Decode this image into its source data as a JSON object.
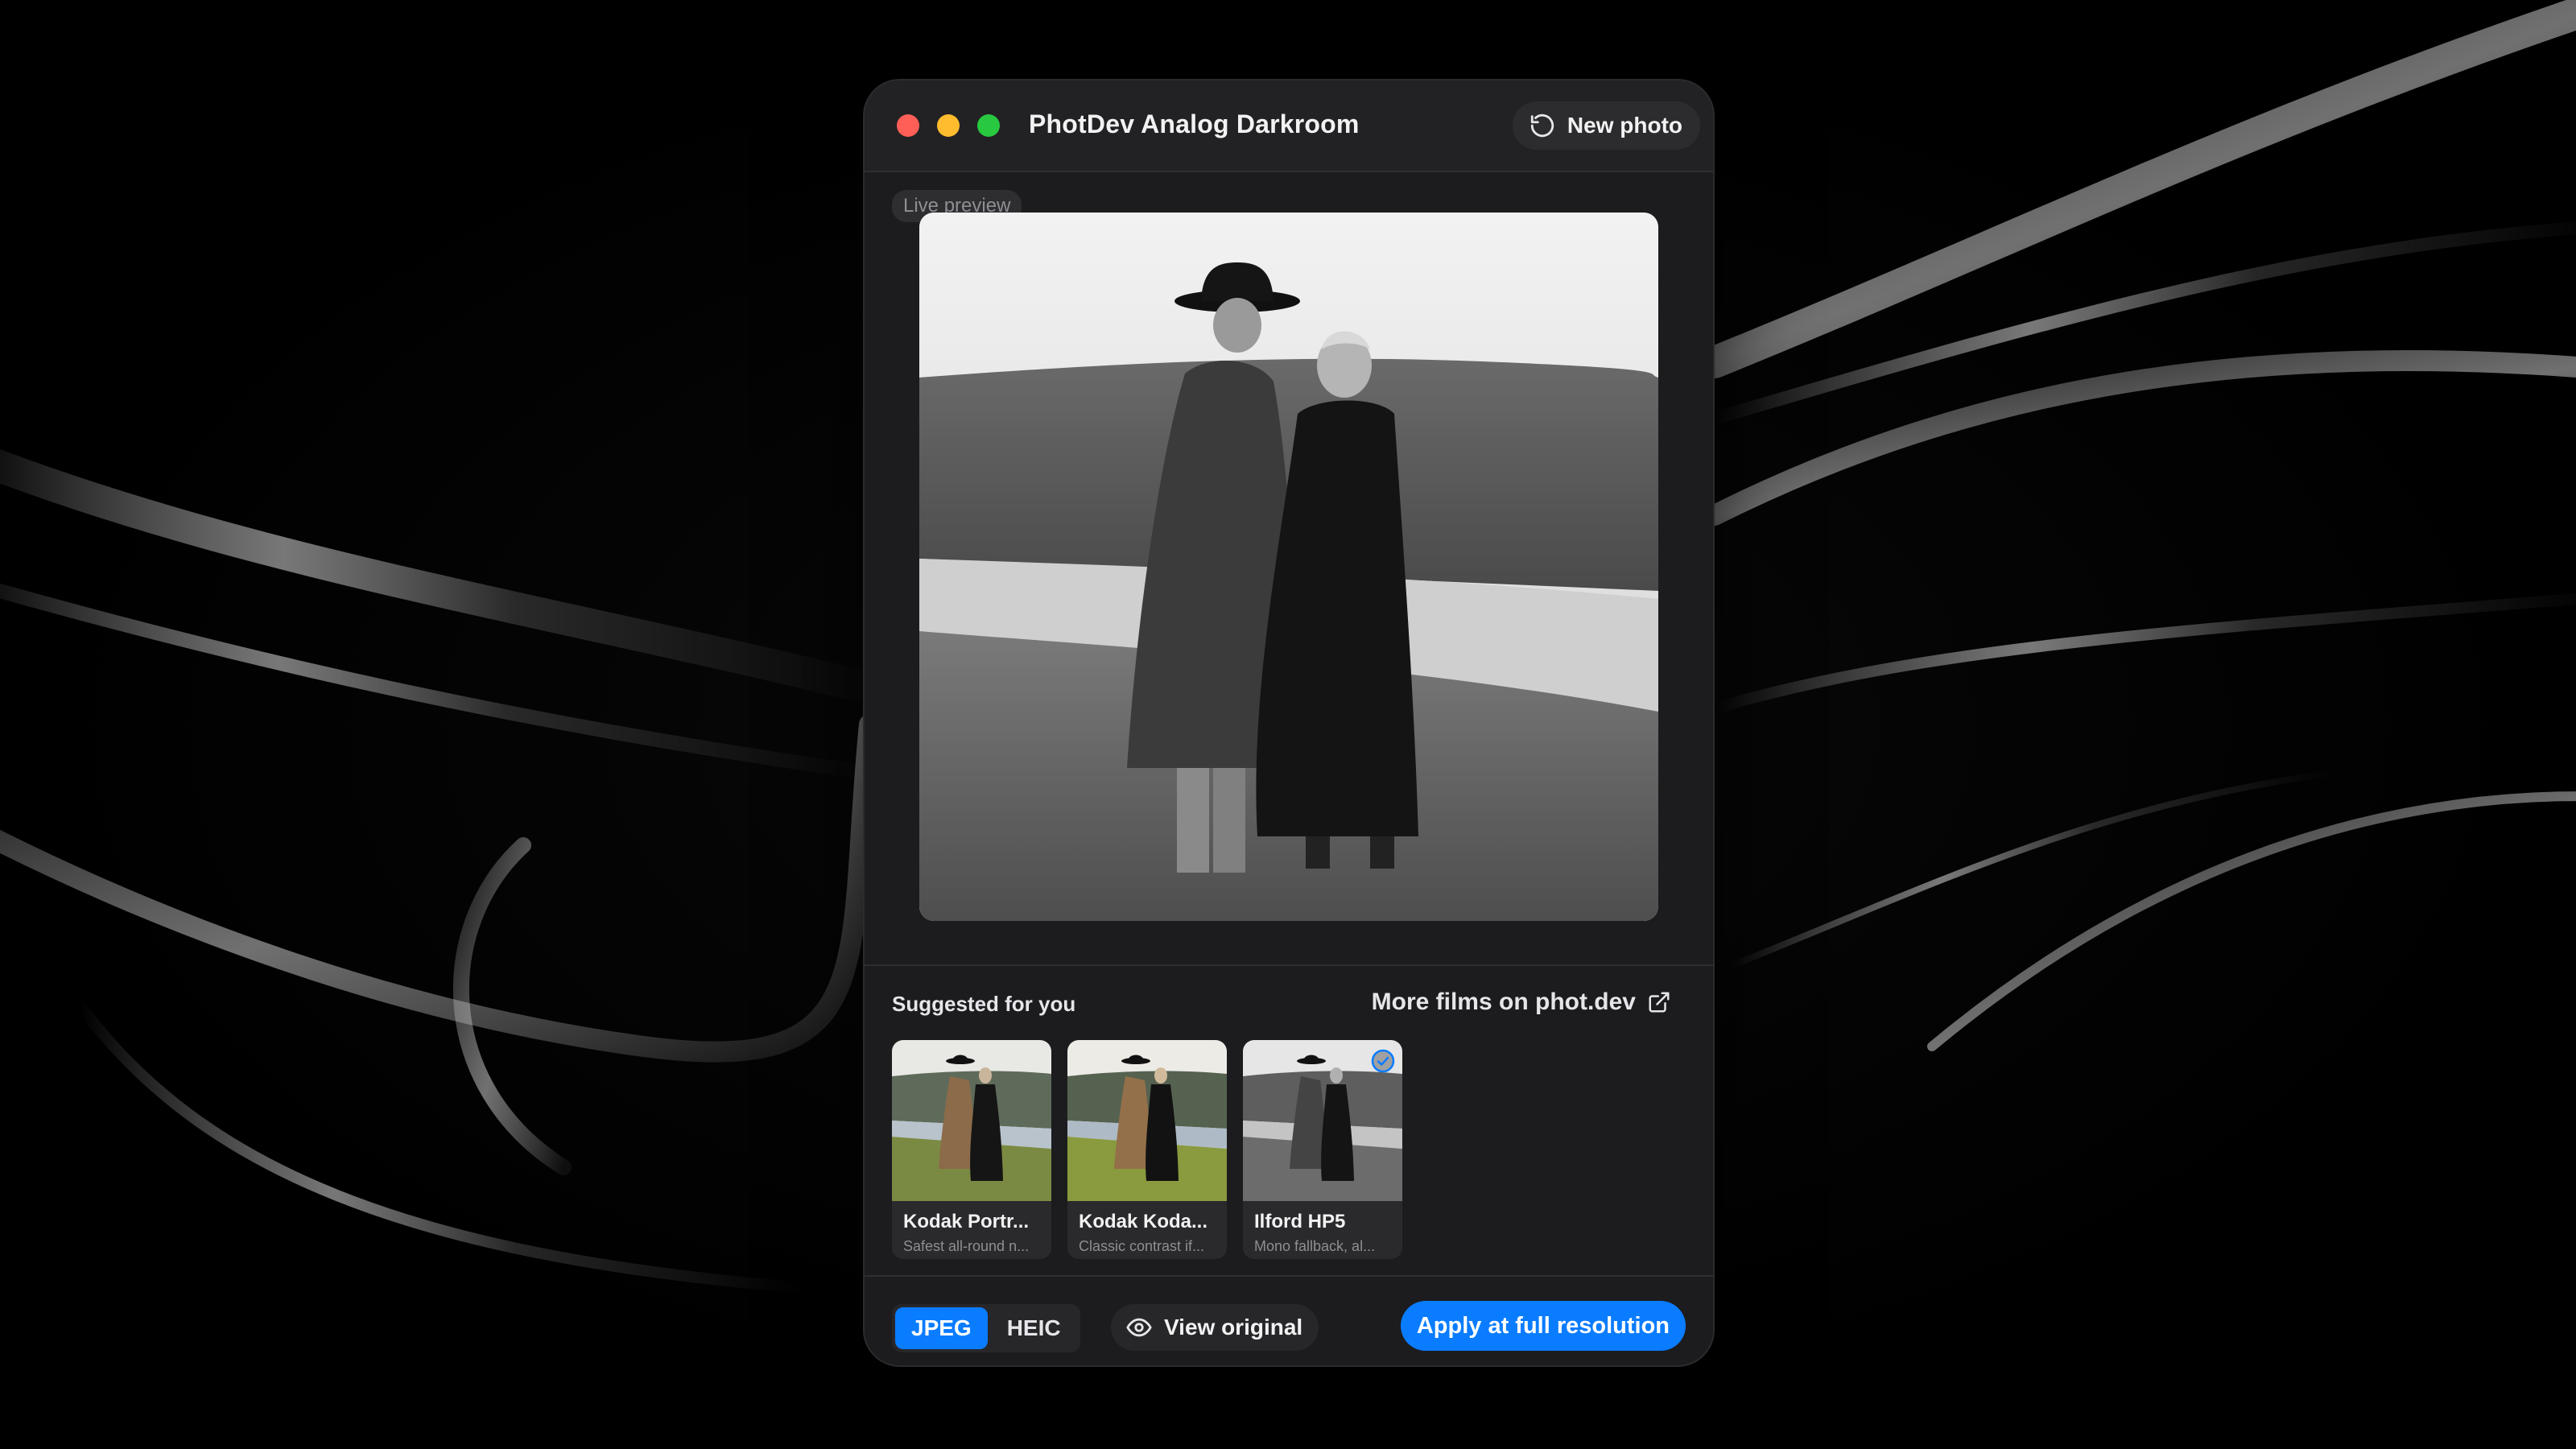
{
  "window": {
    "title": "PhotDev Analog Darkroom",
    "new_photo_label": "New photo"
  },
  "preview": {
    "badge": "Live preview"
  },
  "suggestions": {
    "label": "Suggested for you",
    "more_link": "More films on phot.dev",
    "films": [
      {
        "name": "Kodak Portr...",
        "desc": "Safest all-round n...",
        "tone": "color",
        "selected": false
      },
      {
        "name": "Kodak Koda...",
        "desc": "Classic contrast if...",
        "tone": "color",
        "selected": false
      },
      {
        "name": "Ilford HP5",
        "desc": "Mono fallback, al...",
        "tone": "mono",
        "selected": true
      }
    ]
  },
  "footer": {
    "formats": [
      "JPEG",
      "HEIC"
    ],
    "active_format": "JPEG",
    "view_original_label": "View original",
    "apply_label": "Apply at full resolution"
  },
  "colors": {
    "accent": "#0a7cff",
    "window_bg": "#1c1c1e",
    "close": "#ff5f57",
    "minimize": "#febc2e",
    "zoom": "#28c840"
  }
}
